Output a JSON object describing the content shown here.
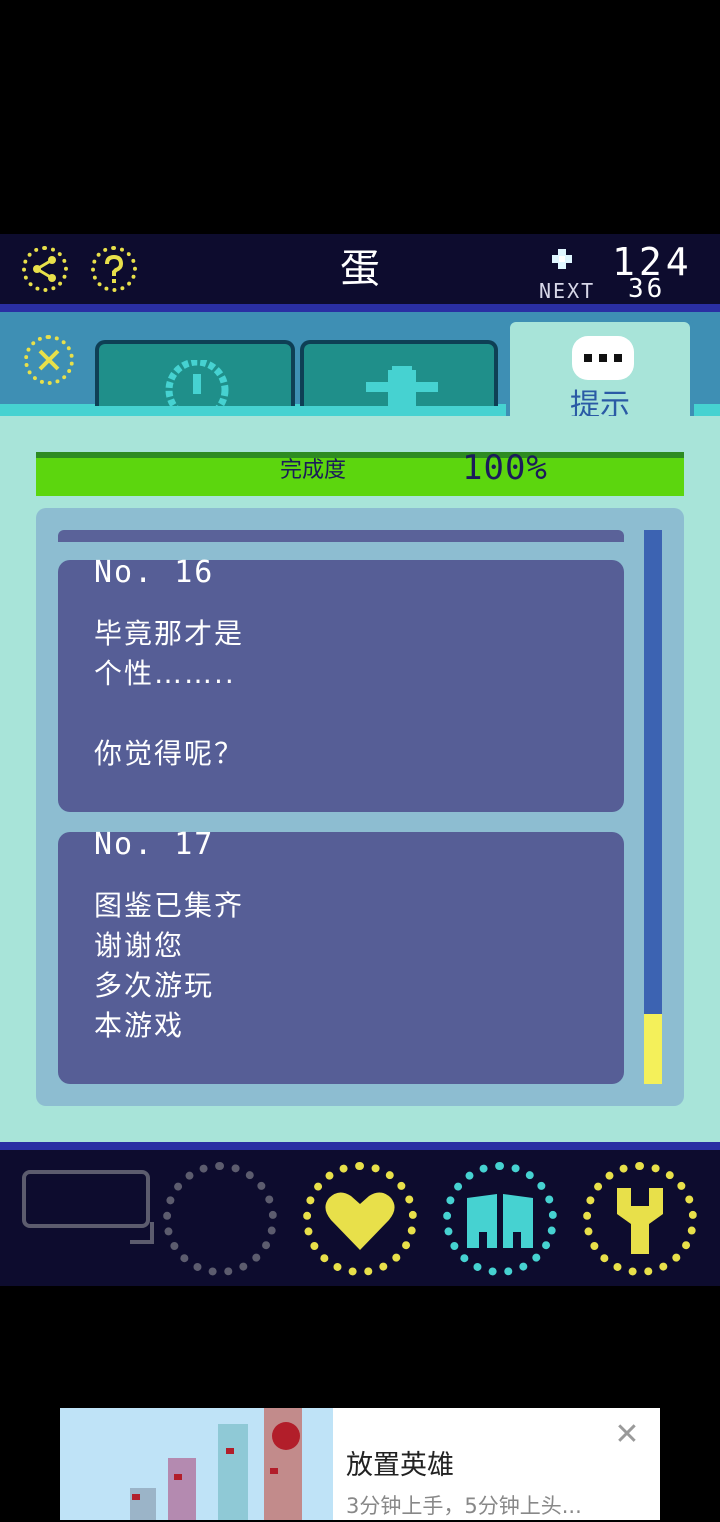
{
  "header": {
    "title": "蛋",
    "coins": "124",
    "next_label": "NEXT",
    "next_value": "36"
  },
  "tabs": {
    "active_label": "提示"
  },
  "progress": {
    "label": "完成度",
    "value": "100%",
    "fraction": 1.0
  },
  "hints": [
    {
      "number": "No. 16",
      "text": "毕竟那才是\n个性……..\n\n你觉得呢？"
    },
    {
      "number": "No. 17",
      "text": "图鉴已集齐\n谢谢您\n多次游玩\n本游戏"
    }
  ],
  "ad": {
    "title": "放置英雄",
    "description": "3分钟上手，5分钟上头..."
  },
  "colors": {
    "accent_yellow": "#e8e04a",
    "accent_cyan": "#46d2d1",
    "progress_green": "#5cd60e",
    "card_bg": "#565e96"
  }
}
